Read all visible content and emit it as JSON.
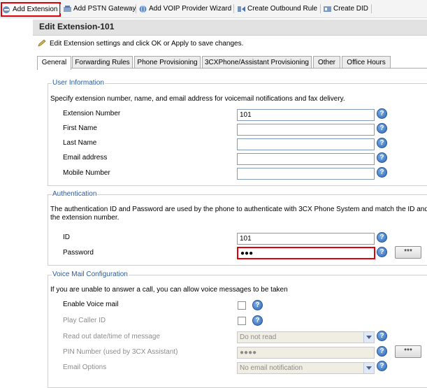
{
  "toolbar": {
    "add_extension": "Add Extension",
    "add_pstn_gateway": "Add PSTN Gateway",
    "add_voip_provider_wizard": "Add VOIP Provider Wizard",
    "create_outbound_rule": "Create Outbound Rule",
    "create_did": "Create DID"
  },
  "page": {
    "title": "Edit Extension-101",
    "instruction": "Edit Extension settings and click OK or Apply to save changes."
  },
  "tabs": [
    "General",
    "Forwarding Rules",
    "Phone Provisioning",
    "3CXPhone/Assistant Provisioning",
    "Other",
    "Office Hours"
  ],
  "user_information": {
    "legend": "User Information",
    "description": "Specify extension number, name, and email address for voicemail notifications and fax delivery.",
    "extension_number": {
      "label": "Extension Number",
      "value": "101"
    },
    "first_name": {
      "label": "First Name",
      "value": ""
    },
    "last_name": {
      "label": "Last Name",
      "value": ""
    },
    "email_address": {
      "label": "Email address",
      "value": ""
    },
    "mobile_number": {
      "label": "Mobile Number",
      "value": ""
    }
  },
  "authentication": {
    "legend": "Authentication",
    "description_line1": "The authentication ID and Password are used by the phone to authenticate with 3CX Phone System and match the ID and Pa",
    "description_line2": "the extension number.",
    "id": {
      "label": "ID",
      "value": "101"
    },
    "password": {
      "label": "Password",
      "value": "●●●"
    },
    "reveal_button": "***"
  },
  "voice_mail": {
    "legend": "Voice Mail Configuration",
    "description": "If you are unable to answer a call, you can allow voice messages to be taken",
    "enable_voice_mail": {
      "label": "Enable Voice mail"
    },
    "play_caller_id": {
      "label": "Play Caller ID"
    },
    "read_out_datetime": {
      "label": "Read out date/time of message",
      "value": "Do not read"
    },
    "pin_number": {
      "label": "PIN Number (used by 3CX Assistant)",
      "value": "●●●●"
    },
    "pin_button": "***",
    "email_options": {
      "label": "Email Options",
      "value": "No email notification"
    }
  },
  "colors": {
    "highlight_red": "#e0000a",
    "legend_blue": "#2a5a9a",
    "help_blue": "#2b66b8"
  },
  "icons": {
    "help": "?"
  }
}
